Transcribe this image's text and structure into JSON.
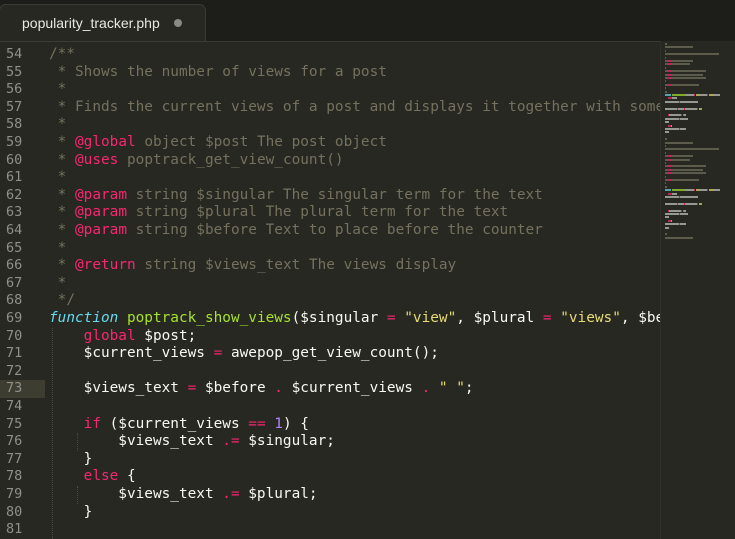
{
  "tab": {
    "filename": "popularity_tracker.php"
  },
  "lines": [
    {
      "n": "54",
      "seg": [
        [
          "cm",
          "/**"
        ]
      ]
    },
    {
      "n": "55",
      "seg": [
        [
          "cm",
          " * Shows the number of views for a post"
        ]
      ]
    },
    {
      "n": "56",
      "seg": [
        [
          "cm",
          " *"
        ]
      ]
    },
    {
      "n": "57",
      "seg": [
        [
          "cm",
          " * Finds the current views of a post and displays it together with some opt"
        ]
      ]
    },
    {
      "n": "58",
      "seg": [
        [
          "cm",
          " *"
        ]
      ]
    },
    {
      "n": "59",
      "seg": [
        [
          "cm",
          " * "
        ],
        [
          "kw",
          "@global"
        ],
        [
          "cm",
          " object $post The post object"
        ]
      ]
    },
    {
      "n": "60",
      "seg": [
        [
          "cm",
          " * "
        ],
        [
          "kw",
          "@uses"
        ],
        [
          "cm",
          " poptrack_get_view_count()"
        ]
      ]
    },
    {
      "n": "61",
      "seg": [
        [
          "cm",
          " *"
        ]
      ]
    },
    {
      "n": "62",
      "seg": [
        [
          "cm",
          " * "
        ],
        [
          "kw",
          "@param"
        ],
        [
          "cm",
          " string $singular The singular term for the text"
        ]
      ]
    },
    {
      "n": "63",
      "seg": [
        [
          "cm",
          " * "
        ],
        [
          "kw",
          "@param"
        ],
        [
          "cm",
          " string $plural The plural term for the text"
        ]
      ]
    },
    {
      "n": "64",
      "seg": [
        [
          "cm",
          " * "
        ],
        [
          "kw",
          "@param"
        ],
        [
          "cm",
          " string $before Text to place before the counter"
        ]
      ]
    },
    {
      "n": "65",
      "seg": [
        [
          "cm",
          " *"
        ]
      ]
    },
    {
      "n": "66",
      "seg": [
        [
          "cm",
          " * "
        ],
        [
          "kw",
          "@return"
        ],
        [
          "cm",
          " string $views_text The views display"
        ]
      ]
    },
    {
      "n": "67",
      "seg": [
        [
          "cm",
          " *"
        ]
      ]
    },
    {
      "n": "68",
      "seg": [
        [
          "cm",
          " */"
        ]
      ]
    },
    {
      "n": "69",
      "seg": [
        [
          "sto",
          "function"
        ],
        [
          "pl",
          " "
        ],
        [
          "fn",
          "poptrack_show_views"
        ],
        [
          "pl",
          "($singular "
        ],
        [
          "kw",
          "="
        ],
        [
          "pl",
          " "
        ],
        [
          "st",
          "\"view\""
        ],
        [
          "pl",
          ", $plural "
        ],
        [
          "kw",
          "="
        ],
        [
          "pl",
          " "
        ],
        [
          "st",
          "\"views\""
        ],
        [
          "pl",
          ", $before"
        ]
      ]
    },
    {
      "n": "70",
      "seg": [
        [
          "pl",
          "    "
        ],
        [
          "kw",
          "global"
        ],
        [
          "pl",
          " $post;"
        ]
      ]
    },
    {
      "n": "71",
      "seg": [
        [
          "pl",
          "    $current_views "
        ],
        [
          "kw",
          "="
        ],
        [
          "pl",
          " awepop_get_view_count();"
        ]
      ]
    },
    {
      "n": "72",
      "seg": [
        [
          "pl",
          ""
        ]
      ]
    },
    {
      "n": "73",
      "active": true,
      "seg": [
        [
          "pl",
          "    $views_text "
        ],
        [
          "kw",
          "="
        ],
        [
          "pl",
          " $before "
        ],
        [
          "kw",
          "."
        ],
        [
          "pl",
          " $current_views "
        ],
        [
          "kw",
          "."
        ],
        [
          "pl",
          " "
        ],
        [
          "st",
          "\" \""
        ],
        [
          "pl",
          ";"
        ]
      ]
    },
    {
      "n": "74",
      "seg": [
        [
          "pl",
          ""
        ]
      ]
    },
    {
      "n": "75",
      "seg": [
        [
          "pl",
          "    "
        ],
        [
          "kw",
          "if"
        ],
        [
          "pl",
          " ($current_views "
        ],
        [
          "kw",
          "=="
        ],
        [
          "pl",
          " "
        ],
        [
          "nm",
          "1"
        ],
        [
          "pl",
          ") {"
        ]
      ]
    },
    {
      "n": "76",
      "seg": [
        [
          "pl",
          "        $views_text "
        ],
        [
          "kw",
          ".="
        ],
        [
          "pl",
          " $singular;"
        ]
      ]
    },
    {
      "n": "77",
      "seg": [
        [
          "pl",
          "    }"
        ]
      ]
    },
    {
      "n": "78",
      "seg": [
        [
          "pl",
          "    "
        ],
        [
          "kw",
          "else"
        ],
        [
          "pl",
          " {"
        ]
      ]
    },
    {
      "n": "79",
      "seg": [
        [
          "pl",
          "        $views_text "
        ],
        [
          "kw",
          ".="
        ],
        [
          "pl",
          " $plural;"
        ]
      ]
    },
    {
      "n": "80",
      "seg": [
        [
          "pl",
          "    }"
        ]
      ]
    },
    {
      "n": "81",
      "seg": [
        [
          "pl",
          ""
        ]
      ]
    }
  ]
}
